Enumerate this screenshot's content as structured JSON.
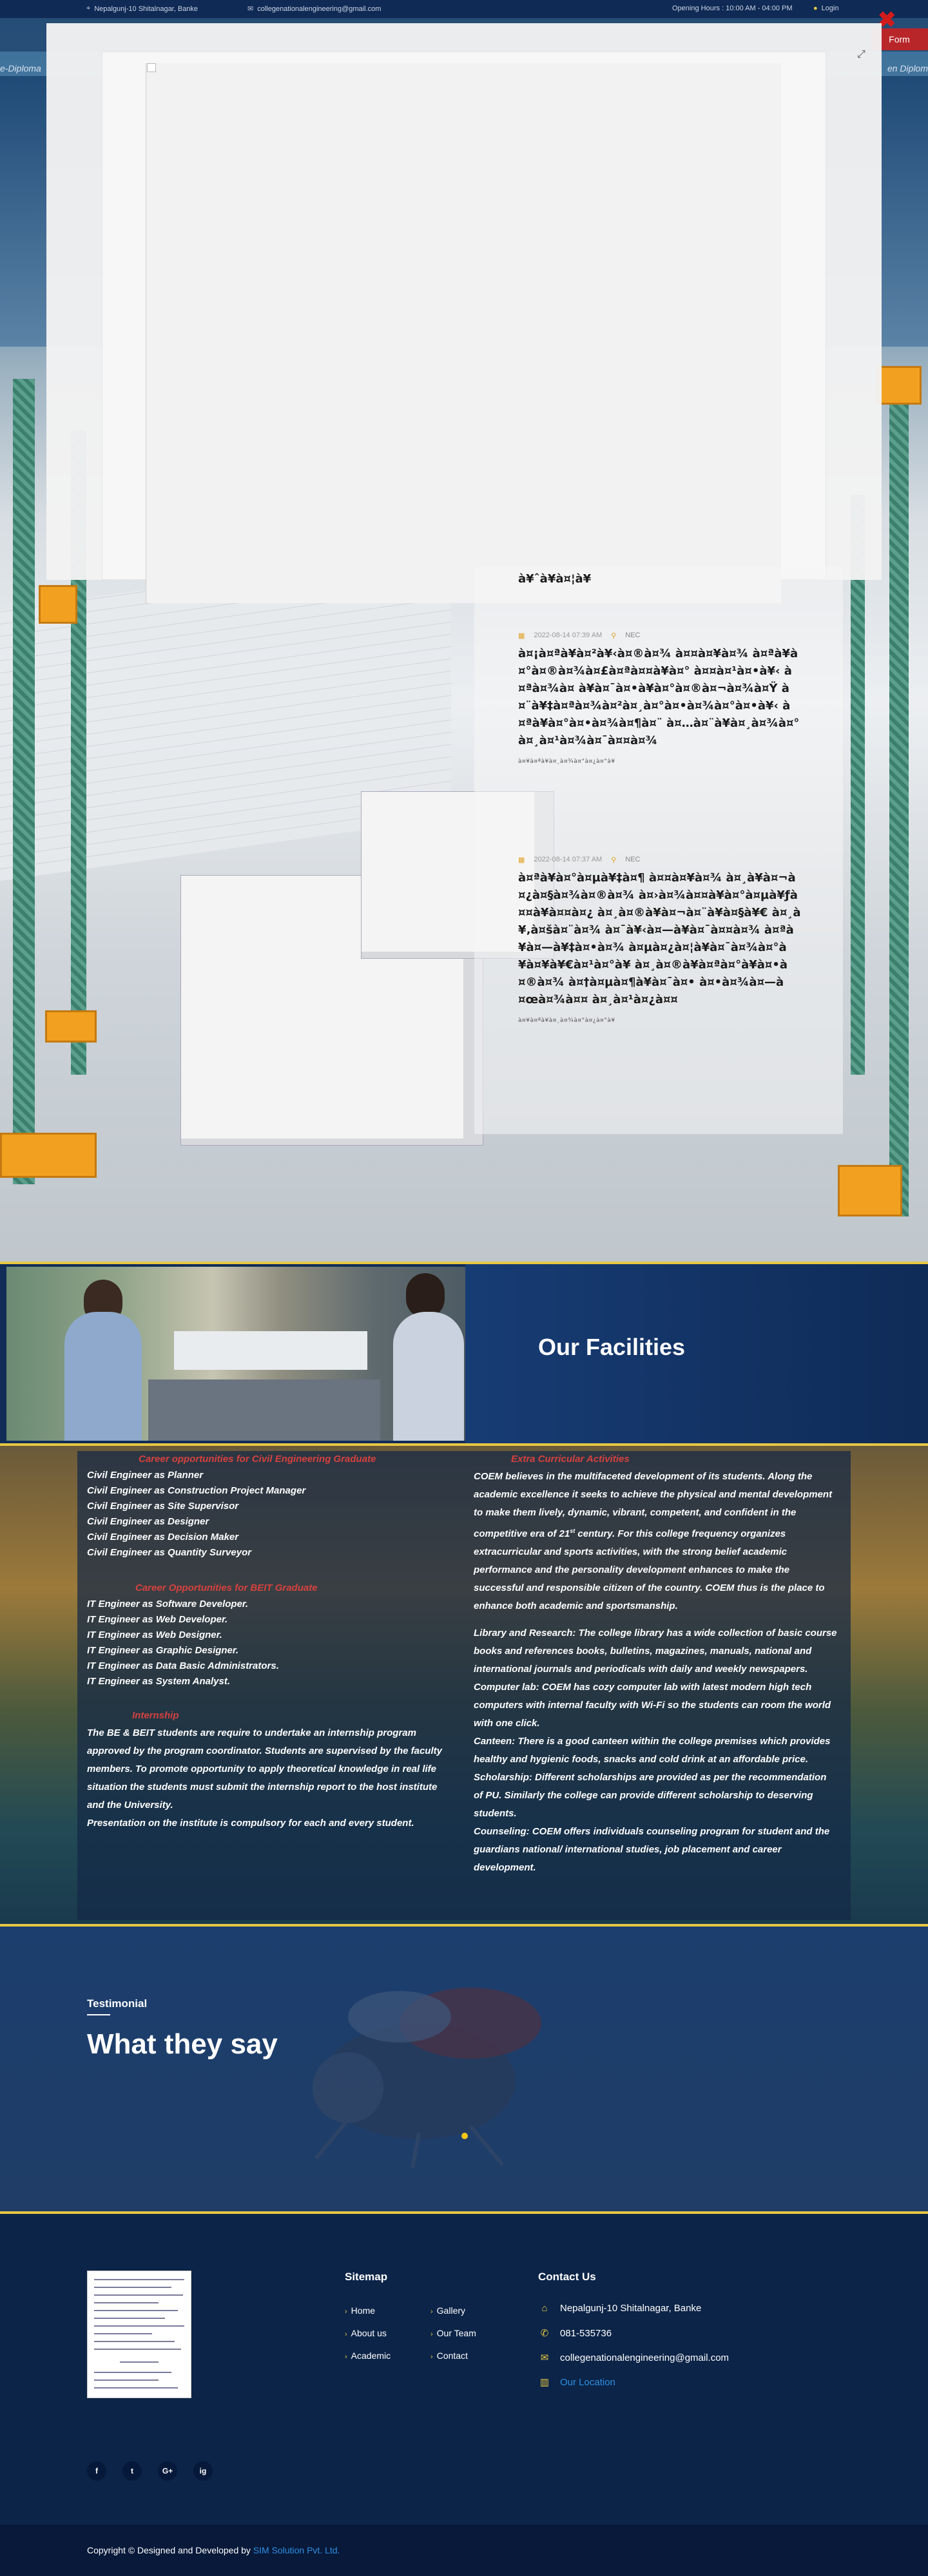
{
  "topbar": {
    "address": "Nepalgunj-10 Shitalnagar, Banke",
    "email": "collegenationalengineering@gmail.com",
    "hours": "Opening Hours : 10:00 AM - 04:00 PM",
    "login": "Login"
  },
  "hero": {
    "left_label": "e-Diploma",
    "right_label": "en Diplom",
    "apply_button": "Form"
  },
  "modal": {
    "close_icon": "close-icon",
    "expand_icon": "expand-icon"
  },
  "news": {
    "top_line": "à¥ˆà¥à¤¦à¥",
    "items": [
      {
        "date": "2022-08-14 07:39 AM",
        "author": "NEC",
        "title": "à¤¡à¤ªà¥à¤²à¥‹à¤®à¤¾ à¤¤à¤¥à¤¾ à¤ªà¥à¤°à¤®à¤¾à¤£à¤ªà¤¤à¥à¤° à¤¤à¤¹à¤•à¥‹ à¤ªà¤¾à¤ à¥à¤¯à¤•à¥à¤°à¤®à¤¬à¤¾à¤Ÿ à¤¨à¥‡à¤ªà¤¾à¤²à¤¸à¤°à¤•à¤¾à¤°à¤•à¥‹ à¤ªà¥à¤°à¤•à¤¾à¤¶à¤¨ à¤…à¤¨à¥à¤¸à¤¾à¤° à¤¸à¤¹à¤¾à¤¯à¤¤à¤¾",
        "more": "à¤¥à¤ªà¥à¤¸à¤¾à¤°à¤¿à¤°à¥"
      },
      {
        "date": "2022-08-14 07:37 AM",
        "author": "NEC",
        "title": "à¤ªà¥à¤°à¤µà¥‡à¤¶ à¤¤à¤¥à¤¾ à¤¸à¥à¤¬à¤¿à¤§à¤¾à¤®à¤¾ à¤›à¤¾à¤¤à¥à¤°à¤µà¥ƒà¤¤à¥à¤¤à¤¿ à¤¸à¤®à¥à¤¬à¤¨à¥à¤§à¥€ à¤¸à¥‚à¤šà¤¨à¤¾ à¤¯à¥‹à¤—à¥à¤¯à¤¤à¤¾ à¤ªà¥à¤—à¥‡à¤•à¤¾ à¤µà¤¿à¤¦à¥à¤¯à¤¾à¤°à¥à¤¥à¥€à¤¹à¤°à¥ à¤¸à¤®à¥à¤ªà¤°à¥à¤•à¤®à¤¾ à¤†à¤µà¤¶à¥à¤¯à¤• à¤•à¤¾à¤—à¤œà¤¾à¤¤ à¤¸à¤¹à¤¿à¤¤",
        "more": "à¤¥à¤ªà¥à¤¸à¤¾à¤°à¤¿à¤°à¥"
      }
    ]
  },
  "facilities": {
    "title": "Our Facilities"
  },
  "careers": {
    "civil_heading": "Career opportunities for Civil Engineering Graduate",
    "civil_items": [
      "Civil Engineer as Planner",
      "Civil Engineer as Construction Project Manager",
      "Civil Engineer as Site Supervisor",
      "Civil Engineer as Designer",
      "Civil Engineer as Decision Maker",
      "Civil Engineer as Quantity Surveyor"
    ],
    "it_heading": "Career Opportunities for BEIT Graduate",
    "it_items": [
      "IT Engineer as Software Developer.",
      "IT Engineer as Web Developer.",
      "IT Engineer as Web Designer.",
      "IT Engineer as Graphic Designer.",
      "IT Engineer as Data Basic Administrators.",
      "IT Engineer as System Analyst."
    ],
    "internship_heading": "Internship",
    "internship_text": "The BE & BEIT students are require to undertake an internship program approved by the program coordinator. Students are supervised by the faculty members. To promote opportunity to apply theoretical knowledge in real life situation the students must submit the internship report to the host institute and the University.",
    "internship_text2": "Presentation on the institute is compulsory for each and every student.",
    "extra_heading": "Extra Curricular Activities",
    "extra_text_a": "COEM believes in the multifaceted development of its students. Along the academic excellence it seeks to achieve the physical and mental development to make them lively, dynamic, vibrant, competent, and confident in the competitive era of 21",
    "extra_text_sup": "st",
    "extra_text_b": " century. For this college frequency organizes extracurricular and sports activities, with the strong belief academic performance and the personality development enhances to make the successful and responsible citizen of the country. COEM thus is the place to enhance both academic and sportsmanship.",
    "library": "Library and Research: The college library has a wide collection of basic course books and references books, bulletins, magazines, manuals, national and international journals and periodicals with daily and weekly newspapers.",
    "computer_lab": "Computer lab: COEM has cozy computer lab with latest modern high tech computers with internal faculty with Wi-Fi so the students can room the world with one click.",
    "canteen": "Canteen: There is a good canteen within the college premises which provides healthy and hygienic foods, snacks and cold drink at an affordable price.",
    "scholarship": "Scholarship: Different scholarships are provided as per the recommendation of PU. Similarly the college can provide different scholarship to deserving students.",
    "counseling": "Counseling: COEM offers individuals counseling program for student and the guardians national/ international studies, job placement and career development."
  },
  "testimonial": {
    "label": "Testimonial",
    "heading": "What they say"
  },
  "footer": {
    "sitemap_title": "Sitemap",
    "sitemap_col1": [
      "Home",
      "About us",
      "Academic"
    ],
    "sitemap_col2": [
      "Gallery",
      "Our Team",
      "Contact"
    ],
    "contact_title": "Contact Us",
    "address": "Nepalgunj-10 Shitalnagar, Banke",
    "phone": "081-535736",
    "email": "collegenationalengineering@gmail.com",
    "location": "Our Location",
    "social": [
      "f",
      "t",
      "G+",
      "ig"
    ],
    "copyright_prefix": "Copyright © Designed and Developed by ",
    "copyright_link": "SIM Solution Pvt. Ltd."
  },
  "colors": {
    "navy": "#0c2448",
    "accent_yellow": "#e7c843",
    "accent_red": "#d6413e",
    "link_blue": "#2f8fe0"
  }
}
